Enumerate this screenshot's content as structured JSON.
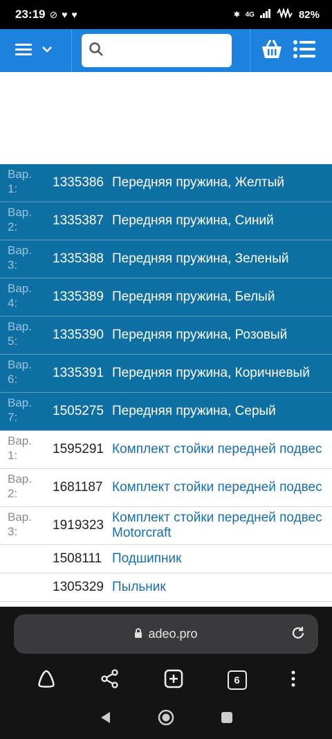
{
  "status_bar": {
    "time": "23:19",
    "network": "4G",
    "battery": "82%"
  },
  "app_bar": {
    "search_placeholder": ""
  },
  "rows": [
    {
      "var": "Вар.\n1:",
      "num": "1335386",
      "name": "Передняя пружина, Желтый",
      "highlight": true
    },
    {
      "var": "Вар.\n2:",
      "num": "1335387",
      "name": "Передняя пружина, Синий",
      "highlight": true
    },
    {
      "var": "Вар.\n3:",
      "num": "1335388",
      "name": "Передняя пружина, Зеленый",
      "highlight": true
    },
    {
      "var": "Вар.\n4:",
      "num": "1335389",
      "name": "Передняя пружина, Белый",
      "highlight": true
    },
    {
      "var": "Вар.\n5:",
      "num": "1335390",
      "name": "Передняя пружина, Розовый",
      "highlight": true
    },
    {
      "var": "Вар.\n6:",
      "num": "1335391",
      "name": "Передняя пружина, Коричневый",
      "highlight": true
    },
    {
      "var": "Вар.\n7:",
      "num": "1505275",
      "name": "Передняя пружина, Серый",
      "highlight": true
    },
    {
      "var": "Вар.\n1:",
      "num": "1595291",
      "name": "Комплект стойки передней подвес",
      "highlight": false
    },
    {
      "var": "Вар.\n2:",
      "num": "1681187",
      "name": "Комплект стойки передней подвес",
      "highlight": false
    },
    {
      "var": "Вар.\n3:",
      "num": "1919323",
      "name": "Комплект стойки передней подвес",
      "name2": "Motorcraft",
      "highlight": false
    },
    {
      "var": "",
      "num": "1508111",
      "name": "Подшипник",
      "highlight": false
    },
    {
      "var": "",
      "num": "1305329",
      "name": "Пыльник",
      "highlight": false
    }
  ],
  "browser": {
    "url": "adeo.pro",
    "tab_count": "6"
  }
}
